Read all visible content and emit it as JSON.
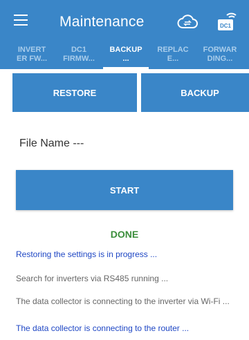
{
  "header": {
    "title": "Maintenance",
    "menu_icon": "menu-icon",
    "cloud_icon": "cloud-sync-icon",
    "device_icon": "dc1-wifi-icon",
    "device_badge": "DC1"
  },
  "tabs": [
    {
      "line1": "INVERT",
      "line2": "ER FW..."
    },
    {
      "line1": "DC1",
      "line2": "FIRMW..."
    },
    {
      "line1": "BACKUP",
      "line2": "..."
    },
    {
      "line1": "REPLAC",
      "line2": "E..."
    },
    {
      "line1": "FORWAR",
      "line2": "DING..."
    }
  ],
  "mode": {
    "restore_label": "RESTORE",
    "backup_label": "BACKUP"
  },
  "file_name": "File Name ---",
  "start_label": "START",
  "done_label": "DONE",
  "status_lines": [
    "Restoring the settings is in progress ...",
    "Search for inverters via RS485 running ...",
    "The data collector is connecting to the inverter via Wi-Fi ...",
    "The data collector is connecting to the router ..."
  ],
  "colors": {
    "primary": "#3a86c8",
    "done": "#3b8e3b",
    "status_active": "#1e46c4",
    "status_inactive": "#666666"
  }
}
